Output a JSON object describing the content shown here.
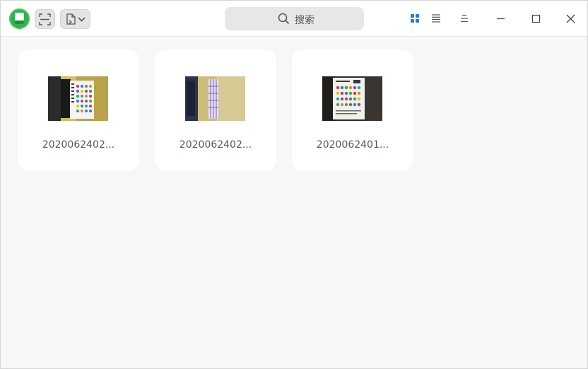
{
  "toolbar": {
    "logo_icon": "album-app-icon",
    "crop_icon": "fullscreen-crop-icon",
    "import_icon": "import-file-icon",
    "import_dropdown_icon": "chevron-down-icon"
  },
  "search": {
    "placeholder": "搜索",
    "icon": "search-icon"
  },
  "view_modes": [
    {
      "name": "grid-view",
      "active": true,
      "color": "#1f7ae0"
    },
    {
      "name": "list-view",
      "active": false
    },
    {
      "name": "menu",
      "active": false
    }
  ],
  "window_controls": [
    "minimize",
    "maximize",
    "close"
  ],
  "files": [
    {
      "name": "2020062402..."
    },
    {
      "name": "2020062402..."
    },
    {
      "name": "2020062401..."
    }
  ],
  "colors": {
    "accent": "#1f7ae0",
    "app_green": "#2eb34e",
    "background": "#f7f7f7",
    "card": "#ffffff"
  }
}
